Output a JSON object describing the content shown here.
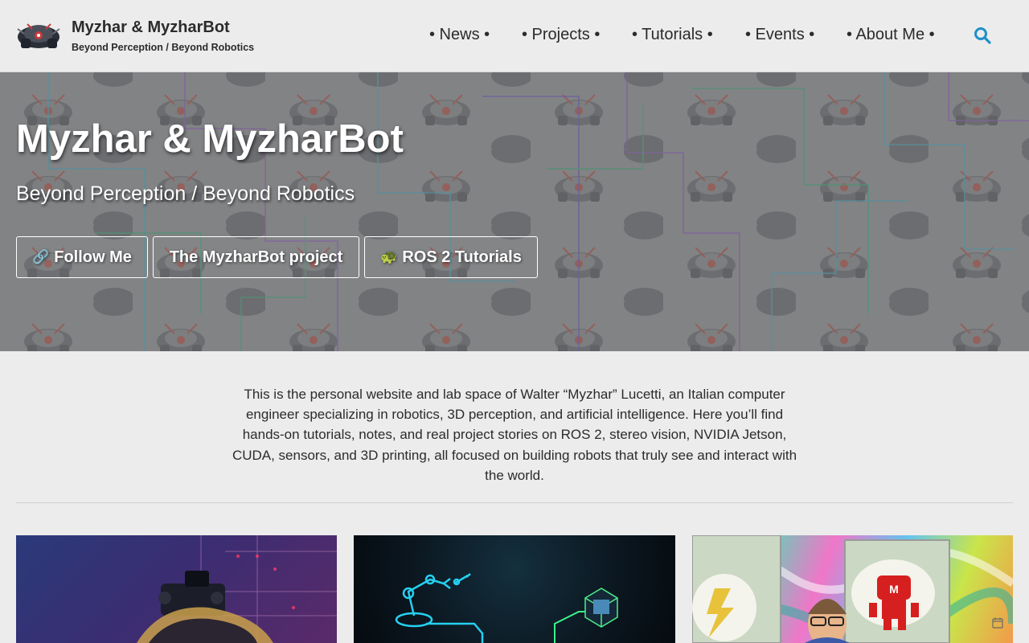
{
  "header": {
    "title": "Myzhar & MyzharBot",
    "subtitle": "Beyond Perception / Beyond Robotics",
    "nav": [
      {
        "label": "• News •"
      },
      {
        "label": "• Projects •"
      },
      {
        "label": "• Tutorials •"
      },
      {
        "label": "• Events •"
      },
      {
        "label": "• About Me •"
      }
    ],
    "search_icon": "search-icon",
    "accent": "#1e90c9"
  },
  "hero": {
    "title": "Myzhar & MyzharBot",
    "subtitle": "Beyond Perception / Beyond Robotics",
    "buttons": [
      {
        "icon": "🔗",
        "label": "Follow Me"
      },
      {
        "icon": "",
        "label": "The MyzharBot project"
      },
      {
        "icon": "🐢",
        "label": "ROS 2 Tutorials"
      }
    ]
  },
  "intro": {
    "text": "This is the personal website and lab space of Walter “Myzhar” Lucetti, an Italian computer engineer specializing in robotics, 3D perception, and artificial intelligence. Here you’ll find hands-on tutorials, notes, and real project stories on ROS 2, stereo vision, NVIDIA Jetson, CUDA, sensors, and 3D printing, all focused on building robots that truly see and interact with the world."
  },
  "cards": [
    {
      "icon": "robot-image"
    },
    {
      "icon": "robot-arm-ai-image"
    },
    {
      "icon": "maker-event-image",
      "badge_icon": "calendar-icon"
    }
  ]
}
